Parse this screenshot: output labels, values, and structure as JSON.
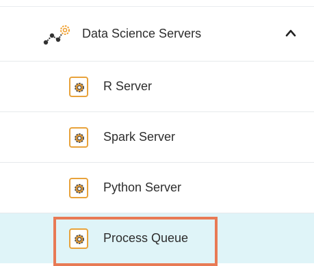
{
  "menu": {
    "parent": {
      "label": "Data Science Servers",
      "icon": "data-science-network-icon",
      "expanded_icon": "chevron-up-icon"
    },
    "items": [
      {
        "label": "R Server",
        "icon": "server-gear-icon"
      },
      {
        "label": "Spark Server",
        "icon": "server-gear-icon"
      },
      {
        "label": "Python Server",
        "icon": "server-gear-icon"
      },
      {
        "label": "Process Queue",
        "icon": "server-gear-icon",
        "selected": true
      }
    ]
  },
  "colors": {
    "selected_row_bg": "#dff4f8",
    "highlight_border": "#e87a55",
    "icon_orange": "#f0a030",
    "icon_outline": "#e8a23a"
  }
}
